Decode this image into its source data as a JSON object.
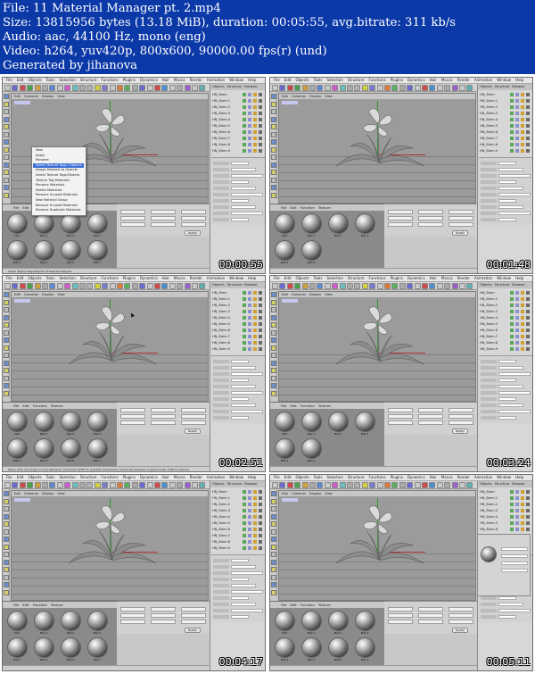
{
  "header": {
    "line1": "File: 11 Material Manager pt. 2.mp4",
    "line2": "Size: 13815956 bytes (13.18 MiB), duration: 00:05:55, avg.bitrate: 311 kb/s",
    "line3": "Audio: aac, 44100 Hz, mono (eng)",
    "line4": "Video: h264, yuv420p, 800x600, 90000.00 fps(r) (und)",
    "line5": "Generated by jihanova"
  },
  "app_menu": [
    "File",
    "Edit",
    "Objects",
    "Tools",
    "Selection",
    "Structure",
    "Functions",
    "Plugins",
    "Dynamics",
    "Hair",
    "Mocca",
    "Render",
    "Animation",
    "Window",
    "Help"
  ],
  "viewport_menu": [
    "Edit",
    "Cameras",
    "Display",
    "View"
  ],
  "panel_tabs": [
    "Objects",
    "Structure",
    "Browser"
  ],
  "material_menu": [
    "File",
    "Edit",
    "Function",
    "Texture"
  ],
  "attr_tabs": [
    "Mode",
    "Edit"
  ],
  "apply_label": "Apply",
  "material_names": [
    "Mat",
    "Mat.1",
    "Mat.2",
    "Mat.3",
    "Mat.4",
    "Mat.5",
    "Mat.6",
    "Mat.7"
  ],
  "object_names": [
    "HN_Stem",
    "HN_Stem.1",
    "HN_Stem.2",
    "HN_Stem.3",
    "HN_Stem.4",
    "HN_Stem.5",
    "HN_Stem.6",
    "HN_Stem.7",
    "HN_Stem.8",
    "HN_Stem.9"
  ],
  "context_menu": [
    "New",
    "Apply",
    "Rename",
    "Select Texture Tags / Objects",
    "Assign Material to Objects",
    "Select Texture Tags/Objects",
    "Texture Tag Materials",
    "Rename Materials",
    "Delete Materials",
    "Remove Unused Materials",
    "New Material Group",
    "Remove Unused Materials",
    "Remove Duplicate Materials"
  ],
  "status_texts": [
    "Select Texture Tags/Objects of Selected Objects",
    "",
    "Move: Click and drag to move elements. Hold down SHIFT to quantize movement / add to the selection in point mode, CTRL to remove.",
    "",
    "",
    ""
  ],
  "timestamps": [
    "00:00:55",
    "00:01:48",
    "00:02:51",
    "00:03:24",
    "00:04:17",
    "00:05:11"
  ],
  "colors": {
    "header_bg": "#0c39a8",
    "viewport_bg": "#9b9b9b",
    "ui_gray": "#d3d3d3",
    "axis_green": "#2e9a2e",
    "axis_red": "#b03030",
    "highlight_blue": "#3d6fd6"
  }
}
